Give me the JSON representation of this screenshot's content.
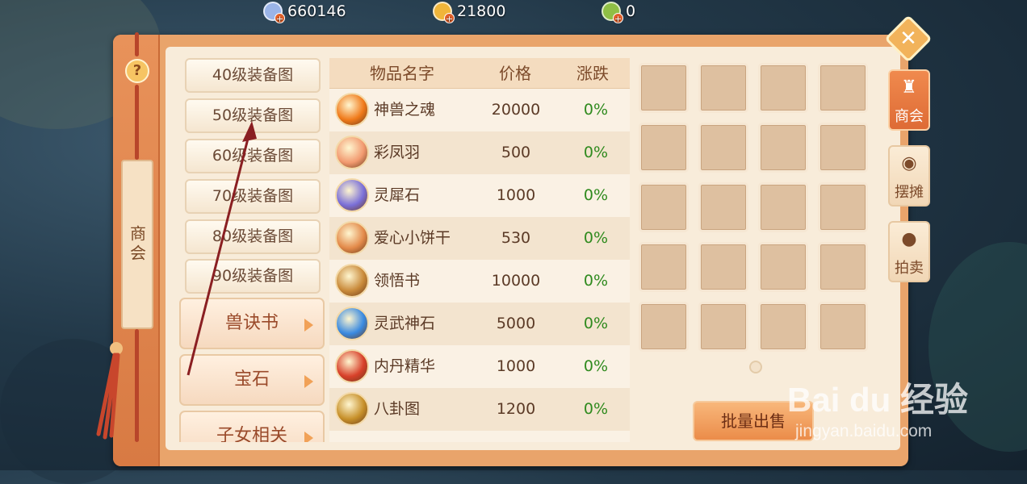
{
  "currency": [
    {
      "icon": "silver-coin-icon",
      "value": "660146",
      "color": "#9ab4e8"
    },
    {
      "icon": "gold-coin-icon",
      "value": "21800",
      "color": "#f0b53a"
    },
    {
      "icon": "jade-coin-icon",
      "value": "0",
      "color": "#8fbf45"
    }
  ],
  "side": {
    "title": "商会"
  },
  "categories": {
    "small": [
      "40级装备图",
      "50级装备图",
      "60级装备图",
      "70级装备图",
      "80级装备图",
      "90级装备图"
    ],
    "big": [
      "兽诀书",
      "宝石",
      "子女相关"
    ]
  },
  "table": {
    "headers": [
      "物品名字",
      "价格",
      "涨跌"
    ],
    "rows": [
      {
        "name": "神兽之魂",
        "price": "20000",
        "change": "0%",
        "icon": "beast-soul-icon",
        "color": "#f07a1a"
      },
      {
        "name": "彩凤羽",
        "price": "500",
        "change": "0%",
        "icon": "phoenix-feather-icon",
        "color": "#f29a70"
      },
      {
        "name": "灵犀石",
        "price": "1000",
        "change": "0%",
        "icon": "spirit-stone-icon",
        "color": "#7a6fd8"
      },
      {
        "name": "爱心小饼干",
        "price": "530",
        "change": "0%",
        "icon": "heart-cookie-icon",
        "color": "#e38a4a"
      },
      {
        "name": "领悟书",
        "price": "10000",
        "change": "0%",
        "icon": "insight-book-icon",
        "color": "#c98a3a"
      },
      {
        "name": "灵武神石",
        "price": "5000",
        "change": "0%",
        "icon": "divine-stone-icon",
        "color": "#3a8ae0"
      },
      {
        "name": "内丹精华",
        "price": "1000",
        "change": "0%",
        "icon": "elixir-icon",
        "color": "#d8402a"
      },
      {
        "name": "八卦图",
        "price": "1200",
        "change": "0%",
        "icon": "bagua-icon",
        "color": "#c7902a"
      }
    ]
  },
  "grid": {
    "rows": 5,
    "cols": 4
  },
  "bulk_sell": "批量出售",
  "tabs": [
    {
      "label": "商会",
      "icon": "guild-icon",
      "active": true
    },
    {
      "label": "摆摊",
      "icon": "stall-icon",
      "active": false
    },
    {
      "label": "拍卖",
      "icon": "auction-icon",
      "active": false
    }
  ],
  "watermark": {
    "main": "Bai du 经验",
    "sub": "jingyan.baidu.com"
  }
}
